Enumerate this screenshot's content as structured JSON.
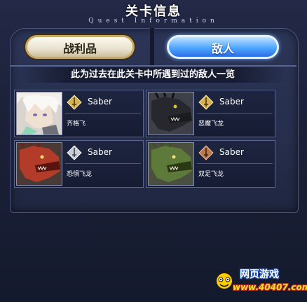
{
  "header": {
    "title": "关卡信息",
    "subtitle": "Quest Information"
  },
  "tabs": [
    {
      "label": "战利品",
      "active": false
    },
    {
      "label": "敌人",
      "active": true
    }
  ],
  "description": "此为过去在此关卡中所遇到过的敌人一览",
  "enemies": [
    {
      "class": "Saber",
      "name": "齐格飞",
      "rank_color": "gold",
      "icon": "saber-class-icon"
    },
    {
      "class": "Saber",
      "name": "恶魔飞龙",
      "rank_color": "gold",
      "icon": "saber-class-icon"
    },
    {
      "class": "Saber",
      "name": "恐惧飞龙",
      "rank_color": "silver",
      "icon": "saber-class-icon"
    },
    {
      "class": "Saber",
      "name": "双足飞龙",
      "rank_color": "bronze",
      "icon": "saber-class-icon"
    }
  ],
  "watermark": {
    "line1": "网页游戏",
    "line2": "www.40407.com"
  },
  "colors": {
    "gold": "#d6b04a",
    "silver": "#c9ccd6",
    "bronze": "#b9784a",
    "active_tab": "#4ea6ff"
  }
}
